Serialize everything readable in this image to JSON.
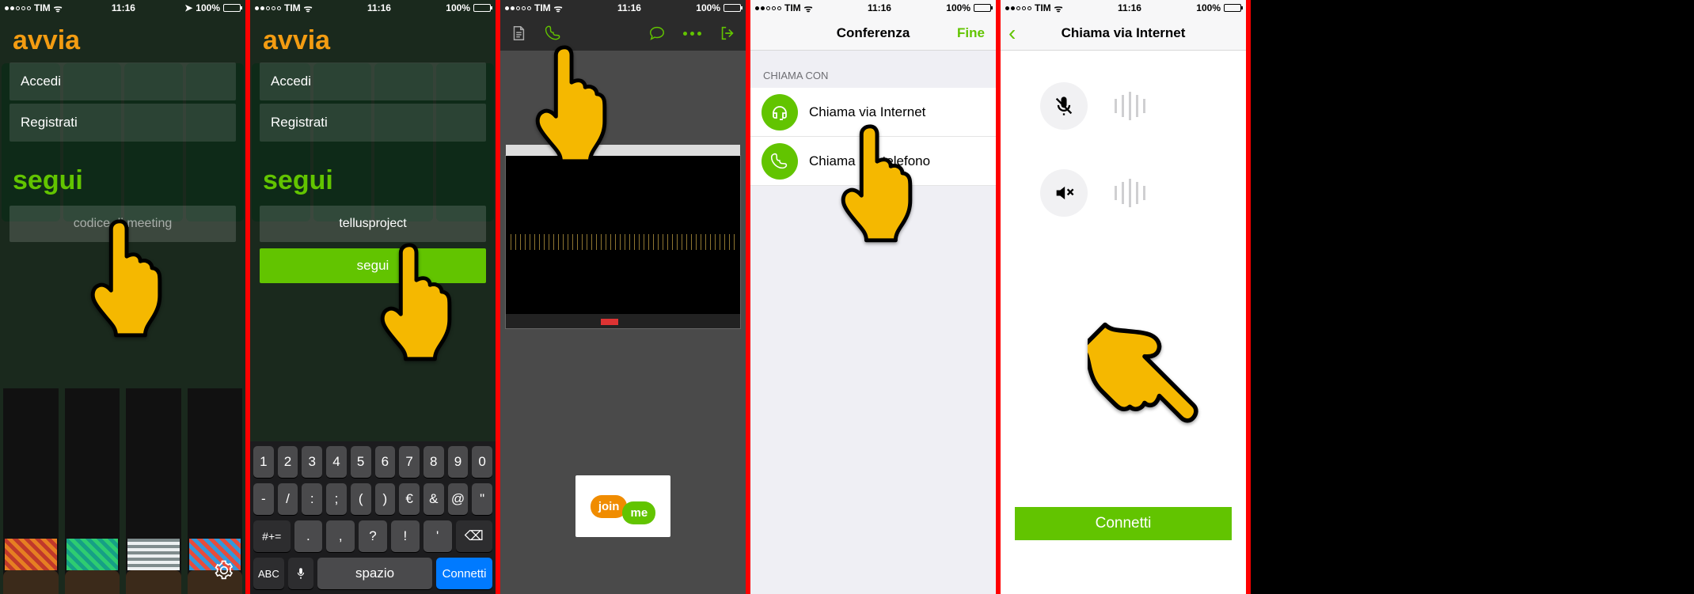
{
  "status": {
    "carrier": "TIM",
    "time": "11:16",
    "battery": "100%"
  },
  "screen1": {
    "avvia": "avvia",
    "accedi": "Accedi",
    "registrati": "Registrati",
    "segui": "segui",
    "placeholder": "codice di meeting"
  },
  "screen2": {
    "avvia": "avvia",
    "accedi": "Accedi",
    "registrati": "Registrati",
    "segui": "segui",
    "input_value": "tellusproject",
    "follow_btn": "segui",
    "keyboard": {
      "row1": [
        "1",
        "2",
        "3",
        "4",
        "5",
        "6",
        "7",
        "8",
        "9",
        "0"
      ],
      "row2": [
        "-",
        "/",
        ":",
        ";",
        "(",
        ")",
        "€",
        "&",
        "@",
        "\""
      ],
      "row3_shift": "#+=",
      "row3": [
        ".",
        ",",
        "?",
        "!",
        "'"
      ],
      "row3_del": "⌫",
      "row4_abc": "ABC",
      "row4_space": "spazio",
      "row4_return": "Connetti"
    }
  },
  "screen3": {
    "joinme1": "join",
    "joinme2": "me"
  },
  "screen4": {
    "title": "Conferenza",
    "done": "Fine",
    "section": "CHIAMA CON",
    "opt1": "Chiama via Internet",
    "opt2": "Chiama per telefono"
  },
  "screen5": {
    "title": "Chiama via Internet",
    "connect": "Connetti"
  }
}
